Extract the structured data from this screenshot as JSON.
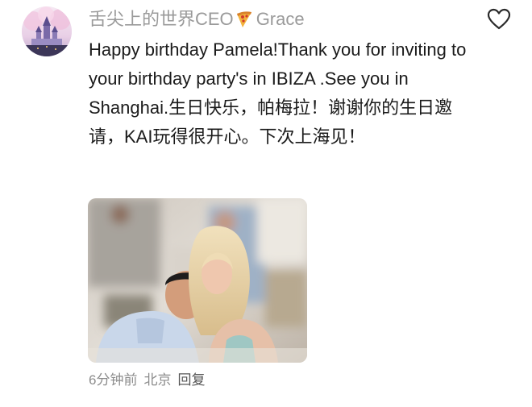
{
  "comment": {
    "username": "舌尖上的世界CEO",
    "username_suffix": "Grace",
    "username_emoji_icon": "pizza-icon",
    "text": "Happy birthday Pamela!Thank you for inviting to your birthday party's in IBIZA .See you in Shanghai.生日快乐，帕梅拉！谢谢你的生日邀请，KAI玩得很开心。下次上海见！",
    "like_icon": "heart-outline-icon",
    "time_ago": "6分钟前",
    "location": "北京",
    "reply_label": "回复"
  },
  "colors": {
    "username": "#9a9a9a",
    "meta": "#8c8c8c",
    "text": "#1b1b1b"
  }
}
